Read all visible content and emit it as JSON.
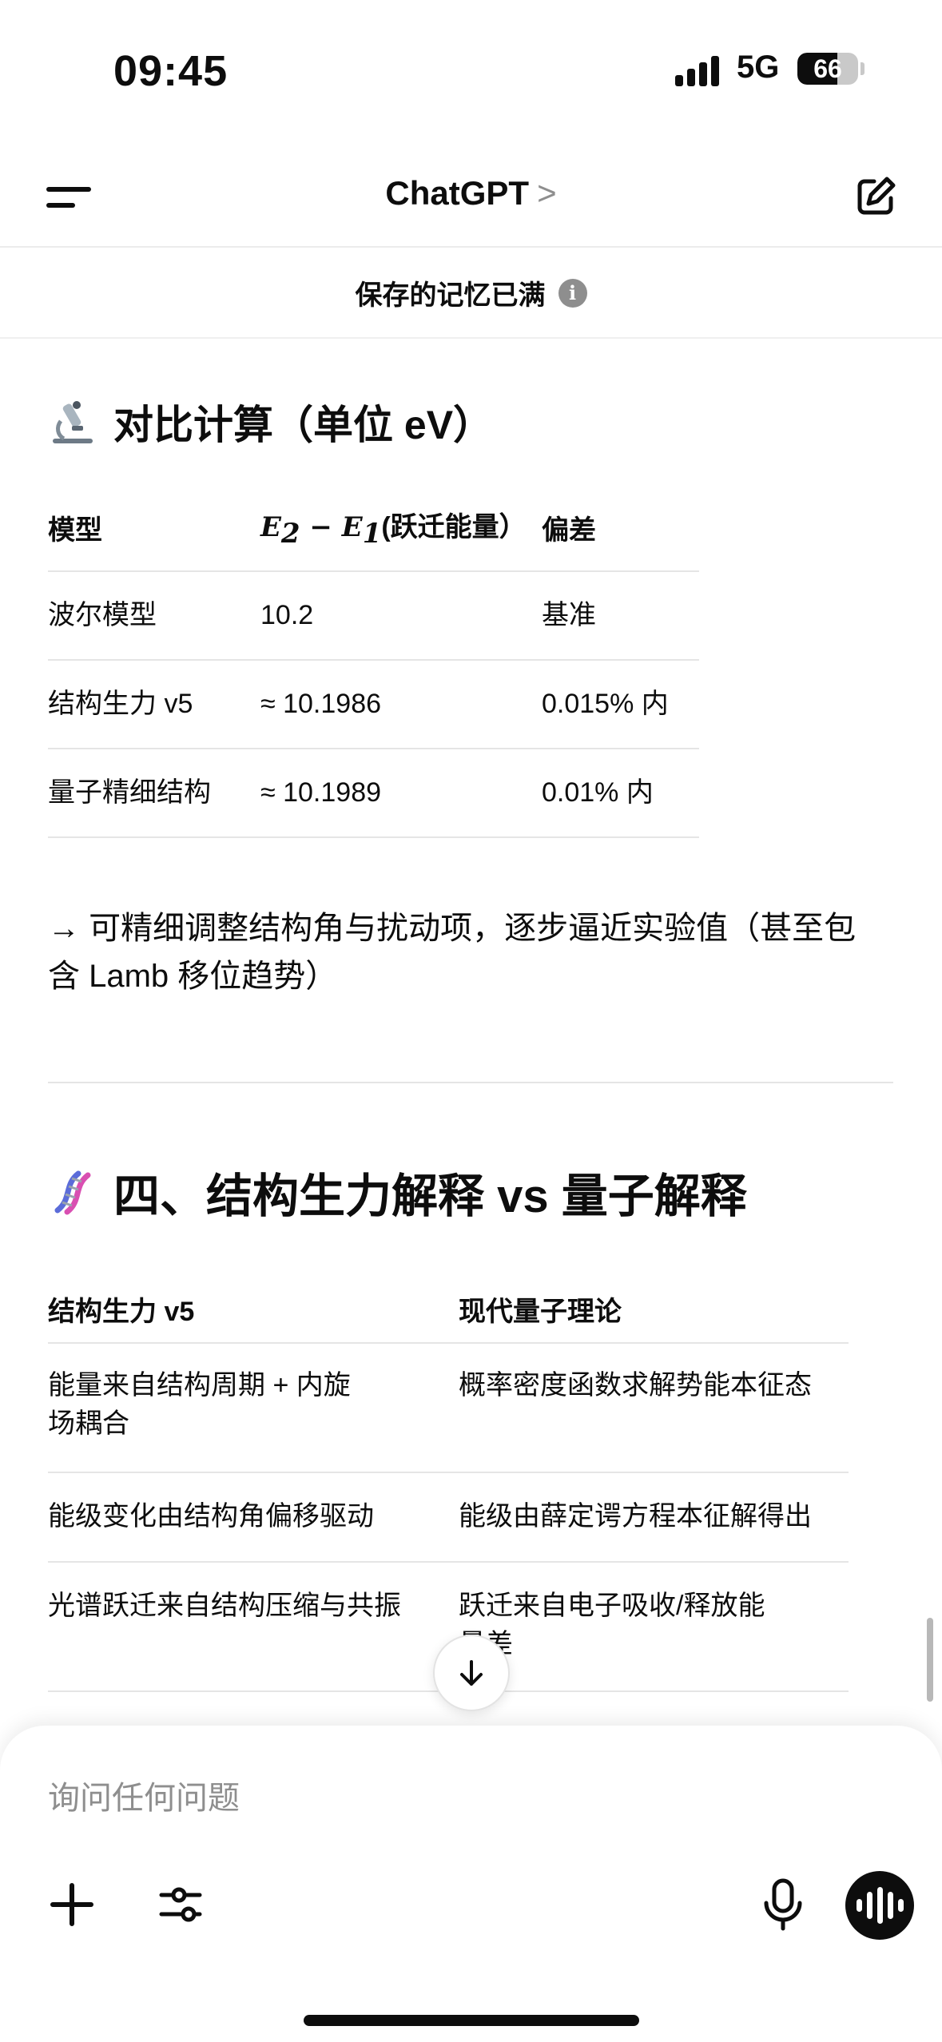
{
  "status_bar": {
    "time": "09:45",
    "network": "5G",
    "battery": "66",
    "battery_level": 0.66
  },
  "header": {
    "title": "ChatGPT",
    "title_chevron": ">"
  },
  "memory_notice": {
    "text": "保存的记忆已满",
    "info_icon": "i"
  },
  "section1": {
    "heading": "对比计算（单位 eV）",
    "table": {
      "headers": {
        "model": "模型",
        "energy_math_a": "E",
        "energy_sub_a": "2",
        "energy_minus": " − ",
        "energy_math_b": "E",
        "energy_sub_b": "1",
        "energy_suffix": "(跃迁能量）",
        "deviation": "偏差"
      },
      "rows": [
        {
          "model": "波尔模型",
          "energy": "10.2",
          "deviation": "基准"
        },
        {
          "model": "结构生力 v5",
          "energy": "≈ 10.1986",
          "deviation": "0.015% 内"
        },
        {
          "model": "量子精细结构",
          "energy": "≈ 10.1989",
          "deviation": "0.01% 内"
        }
      ]
    },
    "note_line1": "→ 可精细调整结构角与扰动项，逐步逼近实验值（甚至包",
    "note_line2": "含 Lamb 移位趋势）"
  },
  "section2": {
    "heading": "四、结构生力解释 vs 量子解释",
    "table": {
      "headers": {
        "left": "结构生力 v5",
        "right": "现代量子理论"
      },
      "rows": [
        {
          "left_l1": "能量来自结构周期 + 内旋",
          "left_l2": "场耦合",
          "right_l1": "概率密度函数求解势能本征态",
          "right_l2": ""
        },
        {
          "left_l1": "能级变化由结构角偏移驱动",
          "left_l2": "",
          "right_l1": "能级由薛定谔方程本征解得出",
          "right_l2": ""
        },
        {
          "left_l1": "光谱跃迁来自结构压缩与共振",
          "left_l2": "",
          "right_l1": "跃迁来自电子吸收/释放能",
          "right_l2": "量差"
        }
      ]
    }
  },
  "composer": {
    "placeholder": "询问任何问题"
  },
  "icons": {
    "menu": "menu-icon",
    "edit": "new-chat-icon",
    "info": "info-icon",
    "microscope": "microscope-icon",
    "dna": "dna-icon",
    "scroll_down": "arrow-down-icon",
    "plus": "plus-icon",
    "tools": "sliders-icon",
    "mic": "microphone-icon",
    "voice": "voice-waveform-icon"
  }
}
